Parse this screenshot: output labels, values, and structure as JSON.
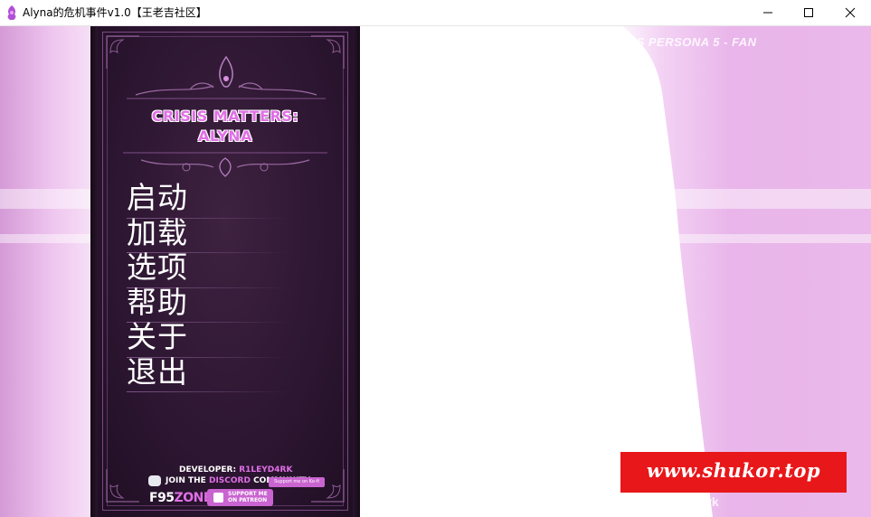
{
  "window": {
    "title": "Alyna的危机事件v1.0【王老吉社区】",
    "icon": "app-icon",
    "controls": [
      "minimize-icon",
      "maximize-icon",
      "close-icon"
    ]
  },
  "game": {
    "title_line1": "CRISIS MATTERS:",
    "title_line2": "ALYNA",
    "menu": [
      "启动",
      "加载",
      "选项",
      "帮助",
      "关于",
      "退出"
    ],
    "background_text": "'S PERSONA 5 - FAN",
    "background_signature": "eyD4rk",
    "credits": {
      "developer_label": "DEVELOPER: ",
      "developer_name": "R1LEYD4RK",
      "discord_prefix": "JOIN THE ",
      "discord_highlight": "DISCORD",
      "discord_suffix": " COMMUNITY",
      "kofi": "Support me on Ko-fi",
      "f95_part1": "F95",
      "f95_part2": "ZONE",
      "patreon_line1": "SUPPORT ME",
      "patreon_line2": "ON PATREON"
    }
  },
  "watermark": {
    "text": "www.shukor.top",
    "bg_color": "#e8171a"
  },
  "colors": {
    "accent_pink": "#e06fe6",
    "panel_bg": "#2b1530",
    "side_pink": "#e9b5ea"
  }
}
